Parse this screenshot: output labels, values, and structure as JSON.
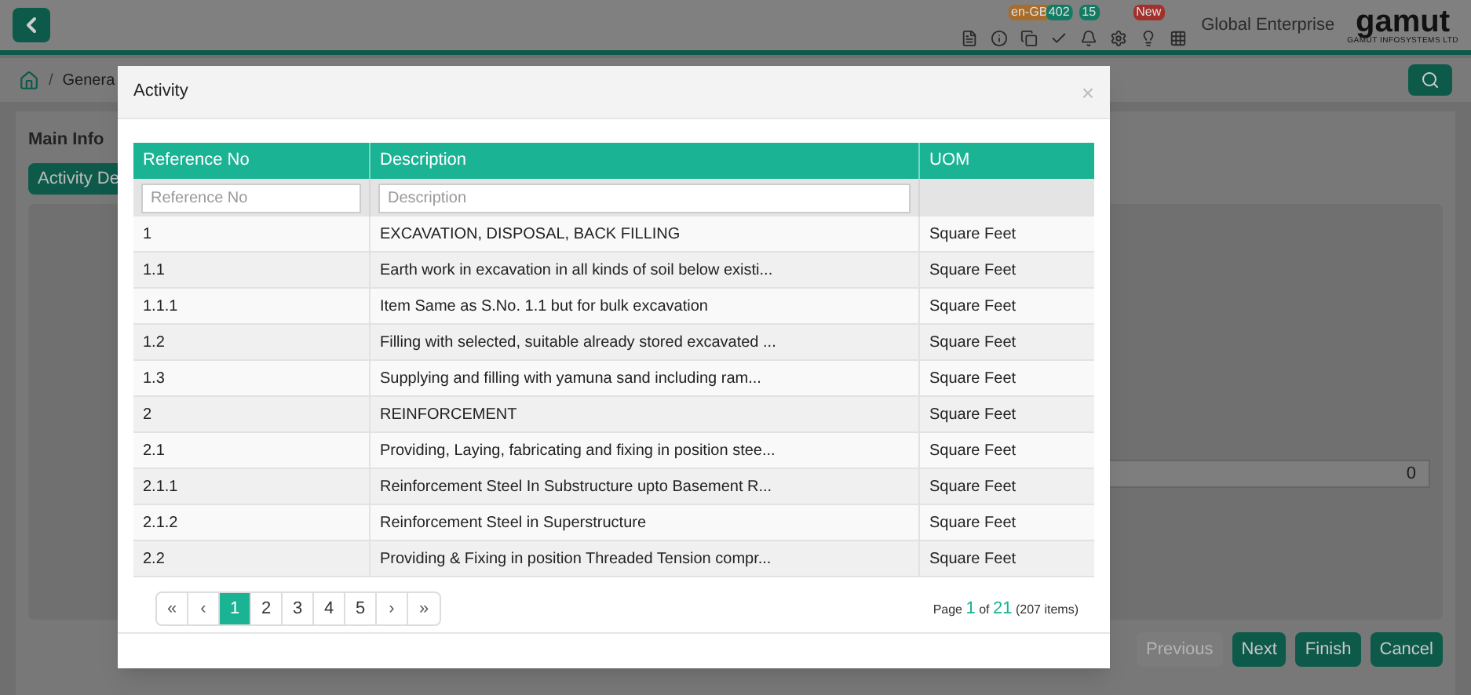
{
  "topbar": {
    "badges": [
      {
        "text": "en-GB",
        "color": "#a86d2a"
      },
      {
        "text": "402",
        "color": "#137a63"
      },
      {
        "text": "15",
        "color": "#137a63"
      },
      {
        "text": "New",
        "color": "#a3302a"
      }
    ],
    "company": "Global Enterprise",
    "logo": "gamut",
    "logo_subtitle": "GAMUT INFOSYSTEMS LTD"
  },
  "breadcrumb": {
    "separator": "/",
    "current": "Genera"
  },
  "page": {
    "section": "Main Info",
    "tab": "Activity De",
    "field_value": "0",
    "buttons": [
      {
        "label": "Previous",
        "disabled": true
      },
      {
        "label": "Next",
        "disabled": false
      },
      {
        "label": "Finish",
        "disabled": false
      },
      {
        "label": "Cancel",
        "disabled": false
      }
    ]
  },
  "modal": {
    "title": "Activity",
    "close": "×",
    "columns": [
      {
        "label": "Reference No",
        "placeholder": "Reference No",
        "filter": true
      },
      {
        "label": "Description",
        "placeholder": "Description",
        "filter": true
      },
      {
        "label": "UOM",
        "filter": false
      }
    ],
    "rows": [
      [
        "1",
        "EXCAVATION, DISPOSAL, BACK FILLING",
        "Square Feet"
      ],
      [
        "1.1",
        "Earth work in excavation in all kinds of soil below existi...",
        "Square Feet"
      ],
      [
        "1.1.1",
        "Item Same as S.No. 1.1 but for bulk excavation",
        "Square Feet"
      ],
      [
        "1.2",
        "Filling with selected, suitable already stored excavated ...",
        "Square Feet"
      ],
      [
        "1.3",
        "Supplying and filling with yamuna sand including ram...",
        "Square Feet"
      ],
      [
        "2",
        "REINFORCEMENT",
        "Square Feet"
      ],
      [
        "2.1",
        "Providing, Laying, fabricating and fixing in position stee...",
        "Square Feet"
      ],
      [
        "2.1.1",
        "Reinforcement Steel In Substructure upto Basement R...",
        "Square Feet"
      ],
      [
        "2.1.2",
        "Reinforcement Steel in Superstructure",
        "Square Feet"
      ],
      [
        "2.2",
        "Providing & Fixing in position Threaded Tension compr...",
        "Square Feet"
      ]
    ],
    "pager": {
      "first": "«",
      "prev": "‹",
      "pages": [
        {
          "label": "1",
          "selected": true
        },
        {
          "label": "2",
          "selected": false
        },
        {
          "label": "3",
          "selected": false
        },
        {
          "label": "4",
          "selected": false
        },
        {
          "label": "5",
          "selected": false
        }
      ],
      "next": "›",
      "last": "»"
    },
    "page_info": {
      "prefix": "Page",
      "current": "1",
      "middle": "of",
      "total": "21",
      "items": "(207 items)"
    }
  }
}
